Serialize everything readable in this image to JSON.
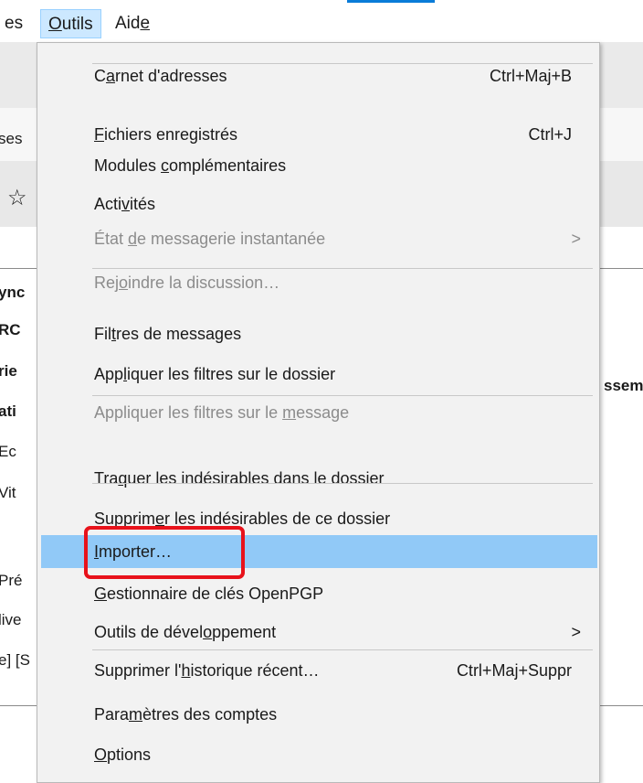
{
  "menubar": {
    "prev_fragment": "es",
    "items": [
      {
        "label": "Outils",
        "underline": "O"
      },
      {
        "label": "Aide",
        "underline": "e"
      }
    ]
  },
  "background": {
    "tab_fragment": "ses",
    "star": "☆",
    "left_fragments": [
      "ync",
      "RC",
      "rie",
      "ati",
      "Ec",
      "Vit",
      "Pré",
      "live",
      "e] [S"
    ],
    "right_fragment": "ssem"
  },
  "menu": {
    "items": [
      {
        "pre": "C",
        "ul": "a",
        "post": "rnet d'adresses",
        "shortcut": "Ctrl+Maj+B",
        "disabled": false
      },
      {
        "sep": true
      },
      {
        "pre": "",
        "ul": "F",
        "post": "ichiers enregistrés",
        "shortcut": "Ctrl+J",
        "disabled": false
      },
      {
        "pre": "Modules ",
        "ul": "c",
        "post": "omplémentaires",
        "shortcut": "",
        "disabled": false
      },
      {
        "pre": "Acti",
        "ul": "v",
        "post": "ités",
        "shortcut": "",
        "disabled": false
      },
      {
        "pre": "État ",
        "ul": "d",
        "post": "e messagerie instantanée",
        "shortcut": "",
        "disabled": true,
        "submenu": true
      },
      {
        "pre": "Rej",
        "ul": "o",
        "post": "indre la discussion…",
        "shortcut": "",
        "disabled": true
      },
      {
        "sep": true
      },
      {
        "pre": "Fil",
        "ul": "t",
        "post": "res de messages",
        "shortcut": "",
        "disabled": false
      },
      {
        "pre": "App",
        "ul": "l",
        "post": "iquer les filtres sur le dossier",
        "shortcut": "",
        "disabled": false
      },
      {
        "pre": "Appliquer les filtres sur le ",
        "ul": "m",
        "post": "essage",
        "shortcut": "",
        "disabled": true
      },
      {
        "sep": true
      },
      {
        "pre": "Tra",
        "ul": "q",
        "post": "uer les indésirables dans le dossier",
        "shortcut": "",
        "disabled": false
      },
      {
        "pre": "Supprim",
        "ul": "e",
        "post": "r les indésirables de ce dossier",
        "shortcut": "",
        "disabled": false
      },
      {
        "sep": true
      },
      {
        "pre": "",
        "ul": "I",
        "post": "mporter…",
        "shortcut": "",
        "disabled": false,
        "highlighted": true
      },
      {
        "pre": "",
        "ul": "G",
        "post": "estionnaire de clés OpenPGP",
        "shortcut": "",
        "disabled": false
      },
      {
        "pre": "Outils de dével",
        "ul": "o",
        "post": "ppement",
        "shortcut": "",
        "disabled": false,
        "submenu": true
      },
      {
        "pre": "Supprimer l'",
        "ul": "h",
        "post": "istorique récent…",
        "shortcut": "Ctrl+Maj+Suppr",
        "disabled": false
      },
      {
        "sep": true
      },
      {
        "pre": "Para",
        "ul": "m",
        "post": "ètres des comptes",
        "shortcut": "",
        "disabled": false
      },
      {
        "pre": "",
        "ul": "O",
        "post": "ptions",
        "shortcut": "",
        "disabled": false
      }
    ],
    "submenu_arrow": ">"
  },
  "colors": {
    "highlight": "#91c9f7",
    "annotation_box": "#e8121b",
    "disabled_text": "#8c8c8c"
  }
}
